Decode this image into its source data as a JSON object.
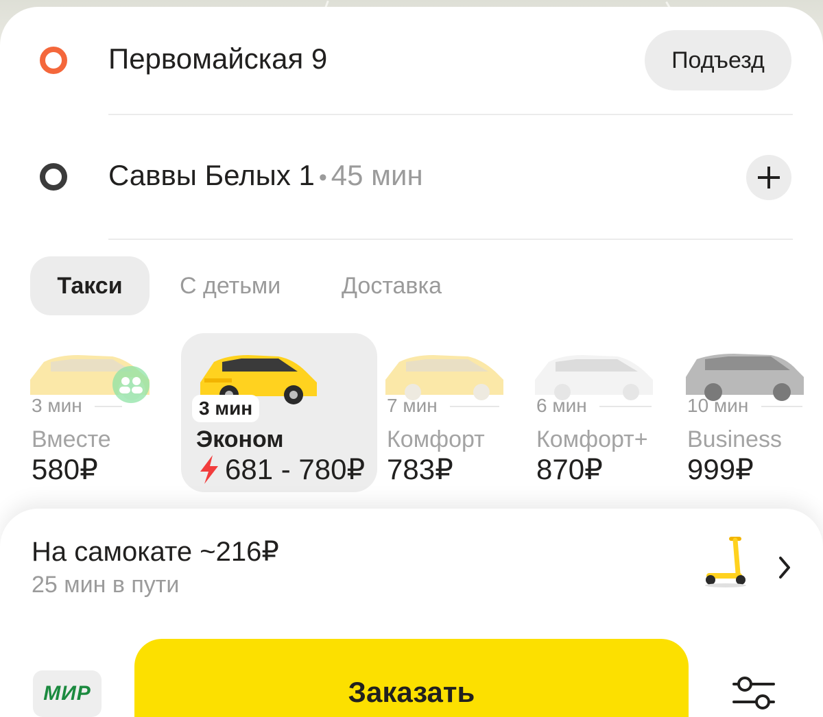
{
  "route": {
    "from": "Первомайская 9",
    "entrance_label": "Подъезд",
    "to": "Саввы Белых 1",
    "separator": "•",
    "to_eta": "45 мин"
  },
  "tabs": [
    {
      "label": "Такси",
      "active": true
    },
    {
      "label": "С детьми",
      "active": false
    },
    {
      "label": "Доставка",
      "active": false
    }
  ],
  "tariffs": [
    {
      "eta": "3 мин",
      "name": "Вместе",
      "price": "580₽",
      "selected": false,
      "car_color": "yellow-faded"
    },
    {
      "eta": "3 мин",
      "name": "Эконом",
      "price": "681 - 780₽",
      "selected": true,
      "car_color": "yellow",
      "surge_icon": "lightning-icon"
    },
    {
      "eta": "7 мин",
      "name": "Комфорт",
      "price": "783₽",
      "selected": false,
      "car_color": "yellow-faded"
    },
    {
      "eta": "6 мин",
      "name": "Комфорт+",
      "price": "870₽",
      "selected": false,
      "car_color": "white"
    },
    {
      "eta": "10 мин",
      "name": "Business",
      "price": "999₽",
      "selected": false,
      "car_color": "grey"
    }
  ],
  "scooter": {
    "title": "На самокате ~216₽",
    "subtitle": "25 мин в пути",
    "icon": "scooter-icon"
  },
  "bottom_bar": {
    "payment_label": "МИР",
    "order_label": "Заказать",
    "settings_icon": "settings-sliders-icon"
  },
  "colors": {
    "accent_yellow": "#fce000",
    "origin_dot": "#f4673b",
    "surge": "#f23d3d",
    "mir_green": "#1b8a3f"
  }
}
